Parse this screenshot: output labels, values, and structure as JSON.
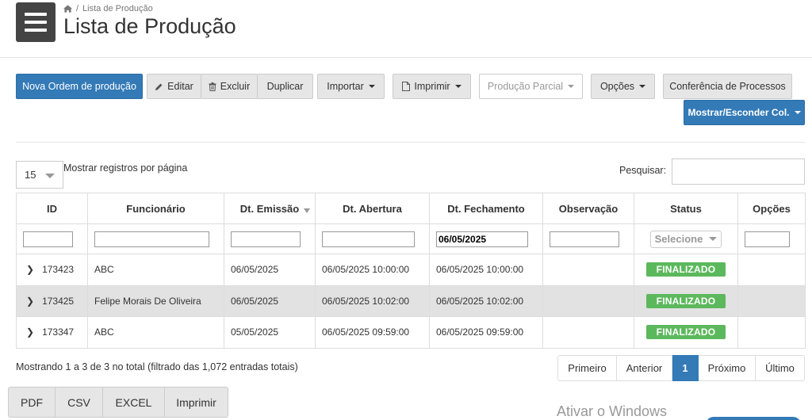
{
  "breadcrumb": {
    "home_icon": "home-icon",
    "separator": "/",
    "current": "Lista de Produção"
  },
  "page": {
    "title": "Lista de Produção"
  },
  "toolbar": {
    "new_order": "Nova Ordem de produção",
    "edit": "Editar",
    "delete": "Excluir",
    "duplicate": "Duplicar",
    "import": "Importar",
    "print": "Imprimir",
    "partial": "Produção Parcial",
    "options": "Opções",
    "conference": "Conferência de Processos",
    "toggle_cols": "Mostrar/Esconder Col."
  },
  "length": {
    "value": "15",
    "label": "Mostrar registros por página"
  },
  "search": {
    "label": "Pesquisar:",
    "value": ""
  },
  "table": {
    "headers": [
      "ID",
      "Funcionário",
      "Dt. Emissão",
      "Dt. Abertura",
      "Dt. Fechamento",
      "Observação",
      "Status",
      "Opções"
    ],
    "filters": {
      "id": "",
      "funcionario": "",
      "emissao": "",
      "abertura": "",
      "fechamento": "06/05/2025",
      "observacao": "",
      "status": "Selecione",
      "opcoes": ""
    },
    "rows": [
      {
        "id": "173423",
        "funcionario": "ABC",
        "emissao": "06/05/2025",
        "abertura": "06/05/2025 10:00:00",
        "fechamento": "06/05/2025 10:00:00",
        "observacao": "",
        "status": "FINALIZADO"
      },
      {
        "id": "173425",
        "funcionario": "Felipe Morais De Oliveira",
        "emissao": "06/05/2025",
        "abertura": "06/05/2025 10:02:00",
        "fechamento": "06/05/2025 10:02:00",
        "observacao": "",
        "status": "FINALIZADO"
      },
      {
        "id": "173347",
        "funcionario": "ABC",
        "emissao": "05/05/2025",
        "abertura": "06/05/2025 09:59:00",
        "fechamento": "06/05/2025 09:59:00",
        "observacao": "",
        "status": "FINALIZADO"
      }
    ]
  },
  "info": "Mostrando 1 a 3 de 3 no total (filtrado das 1,072 entradas totais)",
  "pagination": {
    "first": "Primeiro",
    "prev": "Anterior",
    "current": "1",
    "next": "Próximo",
    "last": "Último"
  },
  "export": {
    "pdf": "PDF",
    "csv": "CSV",
    "excel": "EXCEL",
    "print": "Imprimir"
  },
  "watermark": "Ativar o Windows",
  "colors": {
    "primary": "#337ab7",
    "success": "#5cb85c",
    "menu": "#444444"
  }
}
